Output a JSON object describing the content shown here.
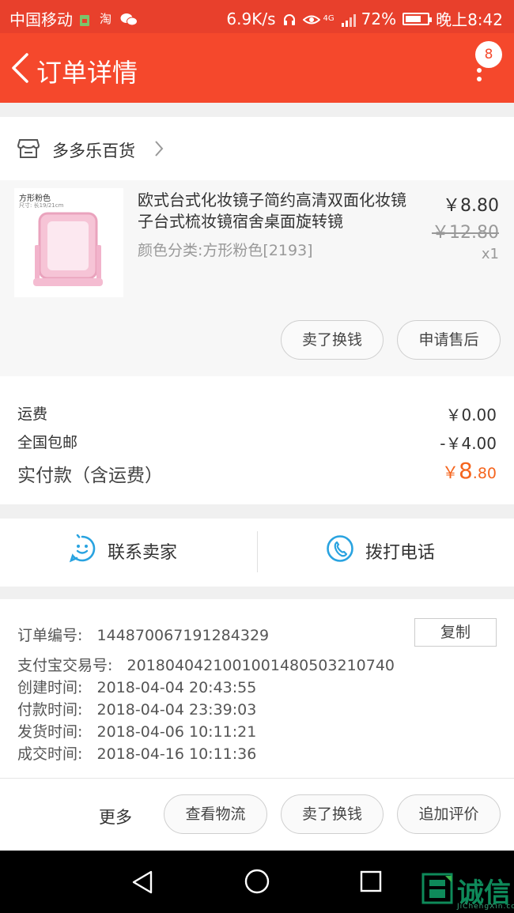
{
  "status_bar": {
    "carrier": "中国移动",
    "network_speed": "6.9K/s",
    "signal_label": "4G",
    "battery": "72%",
    "battery_level": 0.72,
    "time": "晚上8:42"
  },
  "header": {
    "title": "订单详情",
    "badge_count": "8"
  },
  "store": {
    "name": "多多乐百货"
  },
  "product": {
    "thumb_label": "方形粉色",
    "thumb_sub": "尺寸: 长19/21cm",
    "title": "欧式台式化妆镜子简约高清双面化妆镜子台式梳妆镜宿舍桌面旋转镜",
    "spec": "颜色分类:方形粉色[2193]",
    "price": "￥8.80",
    "original_price": "￥12.80",
    "quantity": "x1",
    "buttons": {
      "sell": "卖了换钱",
      "after_sale": "申请售后"
    }
  },
  "fees": {
    "shipping_label": "运费",
    "shipping_value": "￥0.00",
    "free_shipping_label": "全国包邮",
    "free_shipping_value": "-￥4.00",
    "paid_label": "实付款（含运费）",
    "paid_currency": "￥",
    "paid_int": "8",
    "paid_dec": ".80"
  },
  "contact": {
    "seller": "联系卖家",
    "phone": "拨打电话"
  },
  "order_info": {
    "order_no_label": "订单编号:",
    "order_no": "144870067191284329",
    "copy_button": "复制",
    "alipay_label": "支付宝交易号:",
    "alipay_no": "2018040421001001480503210740",
    "created_label": "创建时间:",
    "created": "2018-04-04 20:43:55",
    "paid_label": "付款时间:",
    "paid": "2018-04-04 23:39:03",
    "shipped_label": "发货时间:",
    "shipped": "2018-04-06 10:11:21",
    "completed_label": "成交时间:",
    "completed": "2018-04-16 10:11:36"
  },
  "actions": {
    "more": "更多",
    "logistics": "查看物流",
    "sell": "卖了换钱",
    "review": "追加评价"
  },
  "watermark": {
    "text": "诚信",
    "url": "JiChengXin.com"
  },
  "colors": {
    "brand": "#f5482c",
    "price_accent": "#f5651e",
    "contact_icon": "#29a3e0"
  },
  "icons": {
    "back": "chevron-left-icon",
    "more": "more-vertical-icon",
    "store": "store-icon",
    "chevron": "chevron-right-icon",
    "chat": "chat-face-icon",
    "phone": "phone-icon",
    "nav_back": "triangle-back-icon",
    "nav_home": "circle-home-icon",
    "nav_recent": "square-recent-icon"
  }
}
